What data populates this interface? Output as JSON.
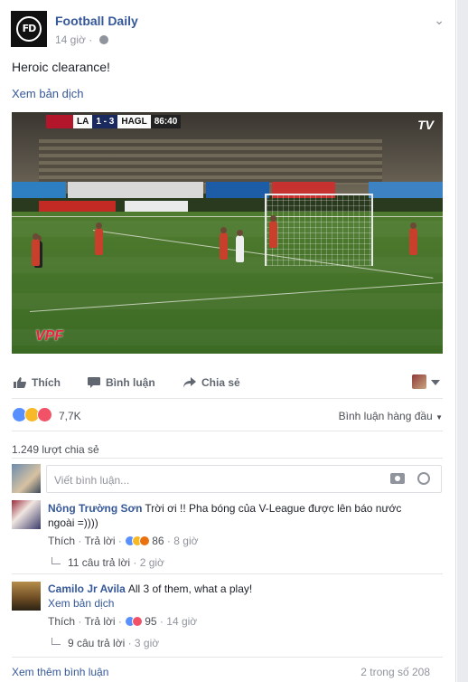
{
  "post": {
    "page_name": "Football Daily",
    "avatar_text": "FD",
    "time": "14 giờ",
    "text": "Heroic clearance!",
    "translate": "Xem bản dịch"
  },
  "video": {
    "score_home": "LA",
    "score": "1 - 3",
    "score_away": "HAGL",
    "clock": "86:40",
    "channel": "TV",
    "watermark": "VPF"
  },
  "actions": {
    "like": "Thích",
    "comment": "Bình luận",
    "share": "Chia sẻ"
  },
  "reactions": {
    "count": "7,7K",
    "sort": "Bình luận hàng đầu",
    "shares": "1.249 lượt chia sẻ"
  },
  "composer": {
    "placeholder": "Viết bình luận..."
  },
  "comments": [
    {
      "name": "Nông Trường Sơn",
      "text": "Trời ơi !! Pha bóng của V-League được lên báo nước ngoài =))))",
      "like": "Thích",
      "reply": "Trả lời",
      "reactions": "86",
      "time": "8 giờ",
      "replies": "11 câu trả lời",
      "replies_time": "2 giờ"
    },
    {
      "name": "Camilo Jr Avila",
      "text": "All 3 of them, what a play!",
      "translate": "Xem bản dịch",
      "like": "Thích",
      "reply": "Trả lời",
      "reactions": "95",
      "time": "14 giờ",
      "replies": "9 câu trả lời",
      "replies_time": "3 giờ"
    }
  ],
  "footer": {
    "more": "Xem thêm bình luận",
    "count": "2 trong số 208"
  },
  "colors": {
    "link": "#365899",
    "like_blue": "#5890ff",
    "love_red": "#f25268",
    "haha_yellow": "#f7b928"
  }
}
